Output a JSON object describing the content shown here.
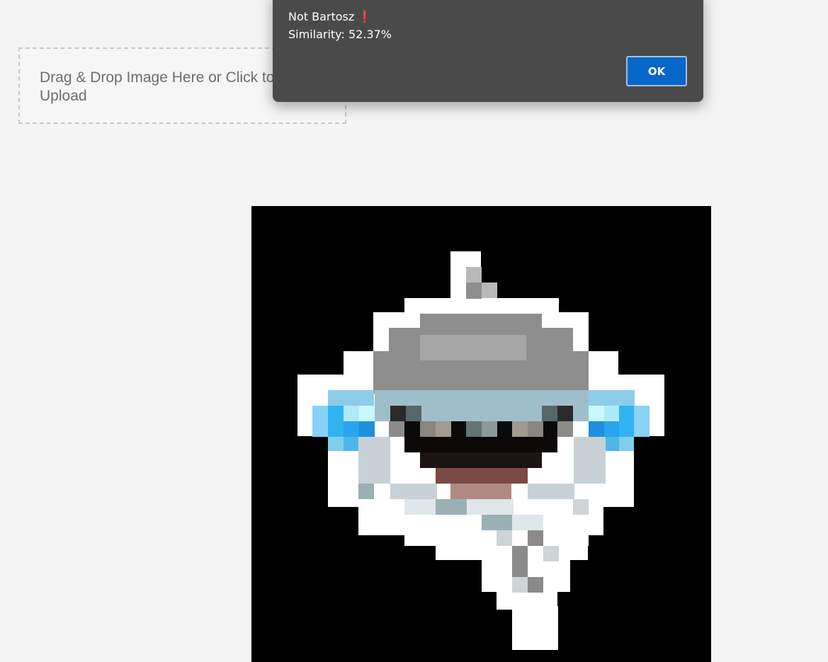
{
  "dropzone": {
    "text": "Drag & Drop Image Here or Click to Upload"
  },
  "preview_image": {
    "icon": "pixelated-crying-laughing-face"
  },
  "dialog": {
    "title_line": "Not Bartosz",
    "title_mark": "❗",
    "similarity_line": "Similarity: 52.37%",
    "ok_label": "OK"
  }
}
